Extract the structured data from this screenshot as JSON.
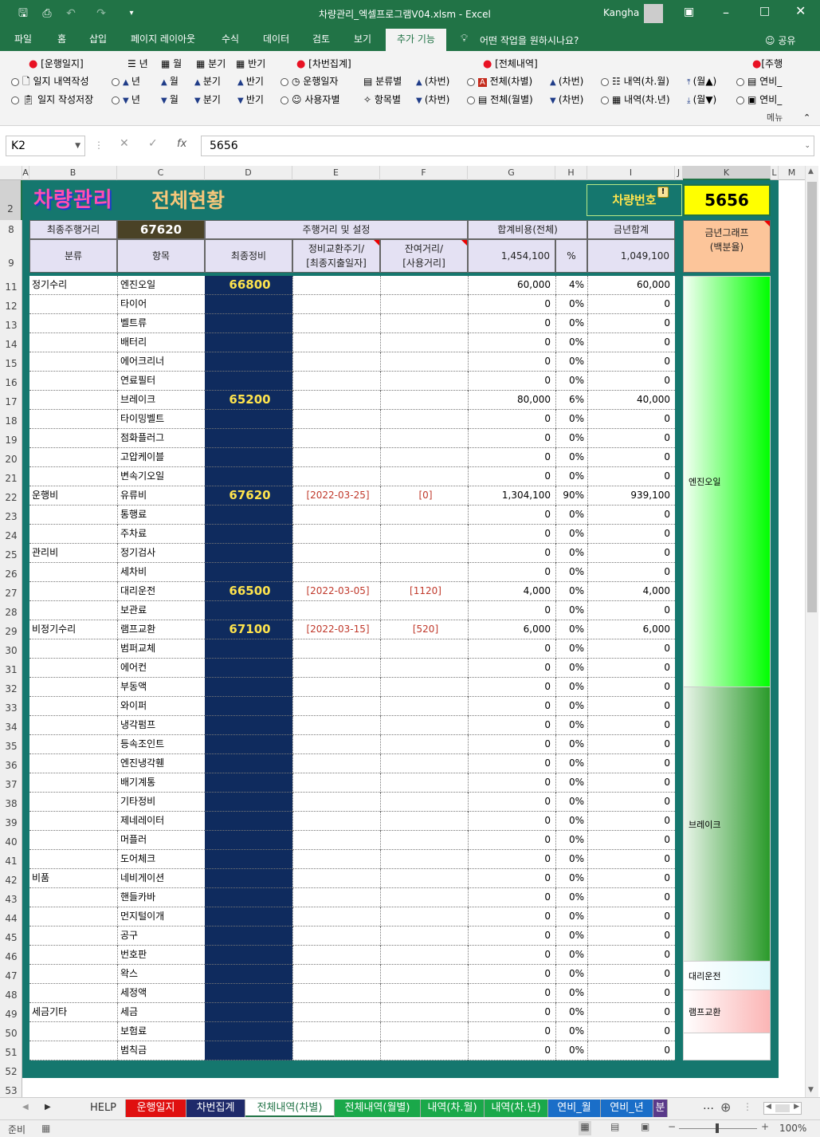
{
  "window": {
    "title": "차량관리_엑셀프로그램V04.xlsm  -  Excel",
    "user": "Kangha"
  },
  "tabs": [
    "파일",
    "홈",
    "삽입",
    "페이지 레이아웃",
    "수식",
    "데이터",
    "검토",
    "보기",
    "추가 기능"
  ],
  "tell_me": "어떤 작업을 원하시나요?",
  "share": "공유",
  "ribbon": {
    "g1_head": "[운행일지]",
    "g1_a": "일지 내역작성",
    "g1_b": "일지 작성저장",
    "p_year": "년",
    "p_month": "월",
    "p_quarter": "분기",
    "p_half": "반기",
    "g2_head": "[차번집계]",
    "g2_a": "운행일자",
    "g2_b": "사용자별",
    "cls": "분류별",
    "item": "항목별",
    "car": "(차번)",
    "g3_head": "[전체내역]",
    "g3_a": "전체(차별)",
    "g3_b": "전체(월별)",
    "g3_c": "내역(차.월)",
    "g3_d": "내역(차.년)",
    "mon_up": "(월▲)",
    "mon_down": "(월▼)",
    "g4_head": "[주행",
    "g4_a": "연비_",
    "g4_b": "연비_",
    "menu": "메뉴"
  },
  "formula": {
    "namebox": "K2",
    "value": "5656"
  },
  "columns": [
    "A",
    "B",
    "C",
    "D",
    "E",
    "F",
    "G",
    "H",
    "I",
    "J",
    "K",
    "L",
    "M"
  ],
  "row_numbers": [
    "2",
    "8",
    "9",
    "11",
    "12",
    "13",
    "14",
    "15",
    "16",
    "17",
    "18",
    "19",
    "20",
    "21",
    "22",
    "23",
    "24",
    "25",
    "26",
    "27",
    "28",
    "29",
    "30",
    "31",
    "32",
    "33",
    "34",
    "35",
    "36",
    "37",
    "38",
    "39",
    "40",
    "41",
    "42",
    "43",
    "44",
    "45",
    "46",
    "47",
    "48",
    "49",
    "50",
    "51",
    "52",
    "53"
  ],
  "sheet": {
    "logo": "차량관리",
    "title": "전체현황",
    "car_label": "차량번호",
    "car_number": "5656",
    "last_mileage_label": "최종주행거리",
    "last_mileage": "67620",
    "mileage_group": "주행거리 및 설정",
    "total_cost_label": "합계비용(전체)",
    "year_total_label": "금년합계",
    "graph_label": "금년그래프\n(백분율)",
    "h_class": "분류",
    "h_item": "항목",
    "h_last": "최종정비",
    "h_cycle": "정비교환주기/\n[최종지출일자]",
    "h_remain": "잔여거리/\n[사용거리]",
    "total_cost": "1,454,100",
    "pct": "%",
    "year_total": "1,049,100"
  },
  "rows": [
    {
      "c": "정기수리",
      "i": "엔진오일",
      "d": "66800",
      "e": "",
      "f": "",
      "g": "60,000",
      "h": "4%",
      "t": "60,000"
    },
    {
      "c": "",
      "i": "타이어",
      "d": "",
      "e": "",
      "f": "",
      "g": "0",
      "h": "0%",
      "t": "0"
    },
    {
      "c": "",
      "i": "벨트류",
      "d": "",
      "e": "",
      "f": "",
      "g": "0",
      "h": "0%",
      "t": "0"
    },
    {
      "c": "",
      "i": "배터리",
      "d": "",
      "e": "",
      "f": "",
      "g": "0",
      "h": "0%",
      "t": "0"
    },
    {
      "c": "",
      "i": "에어크리너",
      "d": "",
      "e": "",
      "f": "",
      "g": "0",
      "h": "0%",
      "t": "0"
    },
    {
      "c": "",
      "i": "연료필터",
      "d": "",
      "e": "",
      "f": "",
      "g": "0",
      "h": "0%",
      "t": "0"
    },
    {
      "c": "",
      "i": "브레이크",
      "d": "65200",
      "e": "",
      "f": "",
      "g": "80,000",
      "h": "6%",
      "t": "40,000"
    },
    {
      "c": "",
      "i": "타이밍벨트",
      "d": "",
      "e": "",
      "f": "",
      "g": "0",
      "h": "0%",
      "t": "0"
    },
    {
      "c": "",
      "i": "점화플러그",
      "d": "",
      "e": "",
      "f": "",
      "g": "0",
      "h": "0%",
      "t": "0"
    },
    {
      "c": "",
      "i": "고압케이블",
      "d": "",
      "e": "",
      "f": "",
      "g": "0",
      "h": "0%",
      "t": "0"
    },
    {
      "c": "",
      "i": "변속기오일",
      "d": "",
      "e": "",
      "f": "",
      "g": "0",
      "h": "0%",
      "t": "0"
    },
    {
      "c": "운행비",
      "i": "유류비",
      "d": "67620",
      "e": "[2022-03-25]",
      "f": "[0]",
      "g": "1,304,100",
      "h": "90%",
      "t": "939,100"
    },
    {
      "c": "",
      "i": "통행료",
      "d": "",
      "e": "",
      "f": "",
      "g": "0",
      "h": "0%",
      "t": "0"
    },
    {
      "c": "",
      "i": "주차료",
      "d": "",
      "e": "",
      "f": "",
      "g": "0",
      "h": "0%",
      "t": "0"
    },
    {
      "c": "관리비",
      "i": "정기검사",
      "d": "",
      "e": "",
      "f": "",
      "g": "0",
      "h": "0%",
      "t": "0"
    },
    {
      "c": "",
      "i": "세차비",
      "d": "",
      "e": "",
      "f": "",
      "g": "0",
      "h": "0%",
      "t": "0"
    },
    {
      "c": "",
      "i": "대리운전",
      "d": "66500",
      "e": "[2022-03-05]",
      "f": "[1120]",
      "g": "4,000",
      "h": "0%",
      "t": "4,000"
    },
    {
      "c": "",
      "i": "보관료",
      "d": "",
      "e": "",
      "f": "",
      "g": "0",
      "h": "0%",
      "t": "0"
    },
    {
      "c": "비정기수리",
      "i": "램프교환",
      "d": "67100",
      "e": "[2022-03-15]",
      "f": "[520]",
      "g": "6,000",
      "h": "0%",
      "t": "6,000"
    },
    {
      "c": "",
      "i": "범퍼교체",
      "d": "",
      "e": "",
      "f": "",
      "g": "0",
      "h": "0%",
      "t": "0"
    },
    {
      "c": "",
      "i": "에어컨",
      "d": "",
      "e": "",
      "f": "",
      "g": "0",
      "h": "0%",
      "t": "0"
    },
    {
      "c": "",
      "i": "부동액",
      "d": "",
      "e": "",
      "f": "",
      "g": "0",
      "h": "0%",
      "t": "0"
    },
    {
      "c": "",
      "i": "와이퍼",
      "d": "",
      "e": "",
      "f": "",
      "g": "0",
      "h": "0%",
      "t": "0"
    },
    {
      "c": "",
      "i": "냉각펌프",
      "d": "",
      "e": "",
      "f": "",
      "g": "0",
      "h": "0%",
      "t": "0"
    },
    {
      "c": "",
      "i": "등속조인트",
      "d": "",
      "e": "",
      "f": "",
      "g": "0",
      "h": "0%",
      "t": "0"
    },
    {
      "c": "",
      "i": "엔진냉각휀",
      "d": "",
      "e": "",
      "f": "",
      "g": "0",
      "h": "0%",
      "t": "0"
    },
    {
      "c": "",
      "i": "배기계통",
      "d": "",
      "e": "",
      "f": "",
      "g": "0",
      "h": "0%",
      "t": "0"
    },
    {
      "c": "",
      "i": "기타정비",
      "d": "",
      "e": "",
      "f": "",
      "g": "0",
      "h": "0%",
      "t": "0"
    },
    {
      "c": "",
      "i": "제네레이터",
      "d": "",
      "e": "",
      "f": "",
      "g": "0",
      "h": "0%",
      "t": "0"
    },
    {
      "c": "",
      "i": "머플러",
      "d": "",
      "e": "",
      "f": "",
      "g": "0",
      "h": "0%",
      "t": "0"
    },
    {
      "c": "",
      "i": "도어체크",
      "d": "",
      "e": "",
      "f": "",
      "g": "0",
      "h": "0%",
      "t": "0"
    },
    {
      "c": "비품",
      "i": "네비게이션",
      "d": "",
      "e": "",
      "f": "",
      "g": "0",
      "h": "0%",
      "t": "0"
    },
    {
      "c": "",
      "i": "핸들카바",
      "d": "",
      "e": "",
      "f": "",
      "g": "0",
      "h": "0%",
      "t": "0"
    },
    {
      "c": "",
      "i": "먼지털이개",
      "d": "",
      "e": "",
      "f": "",
      "g": "0",
      "h": "0%",
      "t": "0"
    },
    {
      "c": "",
      "i": "공구",
      "d": "",
      "e": "",
      "f": "",
      "g": "0",
      "h": "0%",
      "t": "0"
    },
    {
      "c": "",
      "i": "번호판",
      "d": "",
      "e": "",
      "f": "",
      "g": "0",
      "h": "0%",
      "t": "0"
    },
    {
      "c": "",
      "i": "왁스",
      "d": "",
      "e": "",
      "f": "",
      "g": "0",
      "h": "0%",
      "t": "0"
    },
    {
      "c": "",
      "i": "세정액",
      "d": "",
      "e": "",
      "f": "",
      "g": "0",
      "h": "0%",
      "t": "0"
    },
    {
      "c": "세금기타",
      "i": "세금",
      "d": "",
      "e": "",
      "f": "",
      "g": "0",
      "h": "0%",
      "t": "0"
    },
    {
      "c": "",
      "i": "보험료",
      "d": "",
      "e": "",
      "f": "",
      "g": "0",
      "h": "0%",
      "t": "0"
    },
    {
      "c": "",
      "i": "범칙금",
      "d": "",
      "e": "",
      "f": "",
      "g": "0",
      "h": "0%",
      "t": "0"
    }
  ],
  "graph": [
    {
      "label": "엔진오일",
      "pct": 5.7,
      "color": "#00ff00"
    },
    {
      "label": "브레이크",
      "pct": 3.8,
      "color": "#2a9a2a"
    },
    {
      "label": "대리운전",
      "pct": 0.4,
      "color": "#dff8fb"
    },
    {
      "label": "램프교환",
      "pct": 0.6,
      "color": "#fbb5b5"
    }
  ],
  "sheet_tabs": [
    {
      "label": "HELP",
      "color": "#f0f0f0",
      "fg": "#333"
    },
    {
      "label": "운행일지",
      "color": "#e01010",
      "fg": "#fff"
    },
    {
      "label": "차번집계",
      "color": "#1f2a6a",
      "fg": "#fff"
    },
    {
      "label": "전체내역(차별)",
      "color": "#ffffff",
      "fg": "#217346"
    },
    {
      "label": "전체내역(월별)",
      "color": "#1aa84a",
      "fg": "#fff"
    },
    {
      "label": "내역(차.월)",
      "color": "#1aa84a",
      "fg": "#fff"
    },
    {
      "label": "내역(차.년)",
      "color": "#1aa84a",
      "fg": "#fff"
    },
    {
      "label": "연비_월",
      "color": "#1a6ec8",
      "fg": "#fff"
    },
    {
      "label": "연비_년",
      "color": "#1a6ec8",
      "fg": "#fff"
    },
    {
      "label": "분",
      "color": "#5a3a8a",
      "fg": "#fff"
    }
  ],
  "status": {
    "ready": "준비",
    "zoom": "100%"
  }
}
